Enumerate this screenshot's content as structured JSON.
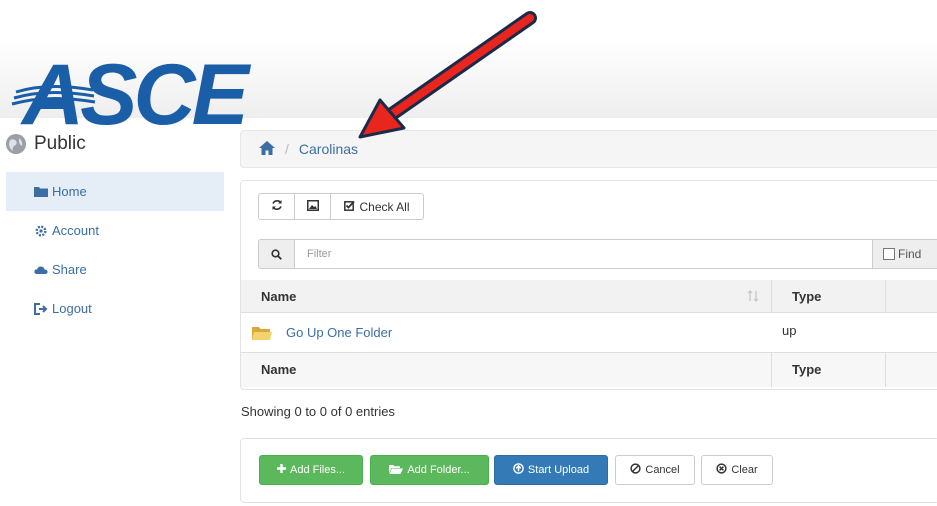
{
  "logo": {
    "text": "ASCE",
    "color": "#1b5ea8"
  },
  "site": {
    "title": "Public",
    "icon": "globe-icon"
  },
  "sidebar": {
    "items": [
      {
        "label": "Home",
        "icon": "folder-icon",
        "active": true
      },
      {
        "label": "Account",
        "icon": "gear-icon",
        "active": false
      },
      {
        "label": "Share",
        "icon": "cloud-icon",
        "active": false
      },
      {
        "label": "Logout",
        "icon": "logout-icon",
        "active": false
      }
    ]
  },
  "breadcrumb": {
    "home_icon": "home-icon",
    "separator": "/",
    "current": "Carolinas"
  },
  "toolbar": {
    "refresh_icon": "refresh-icon",
    "image_icon": "image-icon",
    "check_all_label": "Check All"
  },
  "filter": {
    "placeholder": "Filter",
    "find_label": "Find"
  },
  "table": {
    "columns": [
      "Name",
      "Type"
    ],
    "rows": [
      {
        "name": "Go Up One Folder",
        "type": "up",
        "icon": "folder-up-icon"
      }
    ]
  },
  "status": {
    "showing": "Showing 0 to 0 of 0 entries"
  },
  "upload": {
    "add_files": "Add Files...",
    "add_folder": "Add Folder...",
    "start_upload": "Start Upload",
    "cancel": "Cancel",
    "clear": "Clear"
  },
  "annotation": {
    "arrow_color": "#e8261e",
    "arrow_outline": "#1b2a4a"
  },
  "colors": {
    "link": "#3b6ea5",
    "success": "#5cb85c",
    "primary": "#337ab7"
  }
}
